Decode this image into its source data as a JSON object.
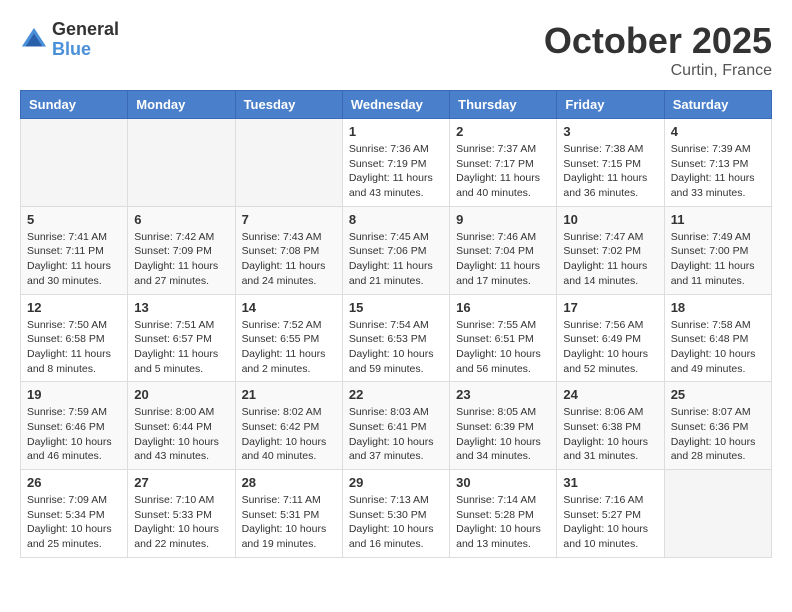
{
  "logo": {
    "general": "General",
    "blue": "Blue"
  },
  "title": "October 2025",
  "location": "Curtin, France",
  "days_of_week": [
    "Sunday",
    "Monday",
    "Tuesday",
    "Wednesday",
    "Thursday",
    "Friday",
    "Saturday"
  ],
  "weeks": [
    [
      {
        "day": "",
        "sunrise": "",
        "sunset": "",
        "daylight": ""
      },
      {
        "day": "",
        "sunrise": "",
        "sunset": "",
        "daylight": ""
      },
      {
        "day": "",
        "sunrise": "",
        "sunset": "",
        "daylight": ""
      },
      {
        "day": "1",
        "sunrise": "Sunrise: 7:36 AM",
        "sunset": "Sunset: 7:19 PM",
        "daylight": "Daylight: 11 hours and 43 minutes."
      },
      {
        "day": "2",
        "sunrise": "Sunrise: 7:37 AM",
        "sunset": "Sunset: 7:17 PM",
        "daylight": "Daylight: 11 hours and 40 minutes."
      },
      {
        "day": "3",
        "sunrise": "Sunrise: 7:38 AM",
        "sunset": "Sunset: 7:15 PM",
        "daylight": "Daylight: 11 hours and 36 minutes."
      },
      {
        "day": "4",
        "sunrise": "Sunrise: 7:39 AM",
        "sunset": "Sunset: 7:13 PM",
        "daylight": "Daylight: 11 hours and 33 minutes."
      }
    ],
    [
      {
        "day": "5",
        "sunrise": "Sunrise: 7:41 AM",
        "sunset": "Sunset: 7:11 PM",
        "daylight": "Daylight: 11 hours and 30 minutes."
      },
      {
        "day": "6",
        "sunrise": "Sunrise: 7:42 AM",
        "sunset": "Sunset: 7:09 PM",
        "daylight": "Daylight: 11 hours and 27 minutes."
      },
      {
        "day": "7",
        "sunrise": "Sunrise: 7:43 AM",
        "sunset": "Sunset: 7:08 PM",
        "daylight": "Daylight: 11 hours and 24 minutes."
      },
      {
        "day": "8",
        "sunrise": "Sunrise: 7:45 AM",
        "sunset": "Sunset: 7:06 PM",
        "daylight": "Daylight: 11 hours and 21 minutes."
      },
      {
        "day": "9",
        "sunrise": "Sunrise: 7:46 AM",
        "sunset": "Sunset: 7:04 PM",
        "daylight": "Daylight: 11 hours and 17 minutes."
      },
      {
        "day": "10",
        "sunrise": "Sunrise: 7:47 AM",
        "sunset": "Sunset: 7:02 PM",
        "daylight": "Daylight: 11 hours and 14 minutes."
      },
      {
        "day": "11",
        "sunrise": "Sunrise: 7:49 AM",
        "sunset": "Sunset: 7:00 PM",
        "daylight": "Daylight: 11 hours and 11 minutes."
      }
    ],
    [
      {
        "day": "12",
        "sunrise": "Sunrise: 7:50 AM",
        "sunset": "Sunset: 6:58 PM",
        "daylight": "Daylight: 11 hours and 8 minutes."
      },
      {
        "day": "13",
        "sunrise": "Sunrise: 7:51 AM",
        "sunset": "Sunset: 6:57 PM",
        "daylight": "Daylight: 11 hours and 5 minutes."
      },
      {
        "day": "14",
        "sunrise": "Sunrise: 7:52 AM",
        "sunset": "Sunset: 6:55 PM",
        "daylight": "Daylight: 11 hours and 2 minutes."
      },
      {
        "day": "15",
        "sunrise": "Sunrise: 7:54 AM",
        "sunset": "Sunset: 6:53 PM",
        "daylight": "Daylight: 10 hours and 59 minutes."
      },
      {
        "day": "16",
        "sunrise": "Sunrise: 7:55 AM",
        "sunset": "Sunset: 6:51 PM",
        "daylight": "Daylight: 10 hours and 56 minutes."
      },
      {
        "day": "17",
        "sunrise": "Sunrise: 7:56 AM",
        "sunset": "Sunset: 6:49 PM",
        "daylight": "Daylight: 10 hours and 52 minutes."
      },
      {
        "day": "18",
        "sunrise": "Sunrise: 7:58 AM",
        "sunset": "Sunset: 6:48 PM",
        "daylight": "Daylight: 10 hours and 49 minutes."
      }
    ],
    [
      {
        "day": "19",
        "sunrise": "Sunrise: 7:59 AM",
        "sunset": "Sunset: 6:46 PM",
        "daylight": "Daylight: 10 hours and 46 minutes."
      },
      {
        "day": "20",
        "sunrise": "Sunrise: 8:00 AM",
        "sunset": "Sunset: 6:44 PM",
        "daylight": "Daylight: 10 hours and 43 minutes."
      },
      {
        "day": "21",
        "sunrise": "Sunrise: 8:02 AM",
        "sunset": "Sunset: 6:42 PM",
        "daylight": "Daylight: 10 hours and 40 minutes."
      },
      {
        "day": "22",
        "sunrise": "Sunrise: 8:03 AM",
        "sunset": "Sunset: 6:41 PM",
        "daylight": "Daylight: 10 hours and 37 minutes."
      },
      {
        "day": "23",
        "sunrise": "Sunrise: 8:05 AM",
        "sunset": "Sunset: 6:39 PM",
        "daylight": "Daylight: 10 hours and 34 minutes."
      },
      {
        "day": "24",
        "sunrise": "Sunrise: 8:06 AM",
        "sunset": "Sunset: 6:38 PM",
        "daylight": "Daylight: 10 hours and 31 minutes."
      },
      {
        "day": "25",
        "sunrise": "Sunrise: 8:07 AM",
        "sunset": "Sunset: 6:36 PM",
        "daylight": "Daylight: 10 hours and 28 minutes."
      }
    ],
    [
      {
        "day": "26",
        "sunrise": "Sunrise: 7:09 AM",
        "sunset": "Sunset: 5:34 PM",
        "daylight": "Daylight: 10 hours and 25 minutes."
      },
      {
        "day": "27",
        "sunrise": "Sunrise: 7:10 AM",
        "sunset": "Sunset: 5:33 PM",
        "daylight": "Daylight: 10 hours and 22 minutes."
      },
      {
        "day": "28",
        "sunrise": "Sunrise: 7:11 AM",
        "sunset": "Sunset: 5:31 PM",
        "daylight": "Daylight: 10 hours and 19 minutes."
      },
      {
        "day": "29",
        "sunrise": "Sunrise: 7:13 AM",
        "sunset": "Sunset: 5:30 PM",
        "daylight": "Daylight: 10 hours and 16 minutes."
      },
      {
        "day": "30",
        "sunrise": "Sunrise: 7:14 AM",
        "sunset": "Sunset: 5:28 PM",
        "daylight": "Daylight: 10 hours and 13 minutes."
      },
      {
        "day": "31",
        "sunrise": "Sunrise: 7:16 AM",
        "sunset": "Sunset: 5:27 PM",
        "daylight": "Daylight: 10 hours and 10 minutes."
      },
      {
        "day": "",
        "sunrise": "",
        "sunset": "",
        "daylight": ""
      }
    ]
  ]
}
